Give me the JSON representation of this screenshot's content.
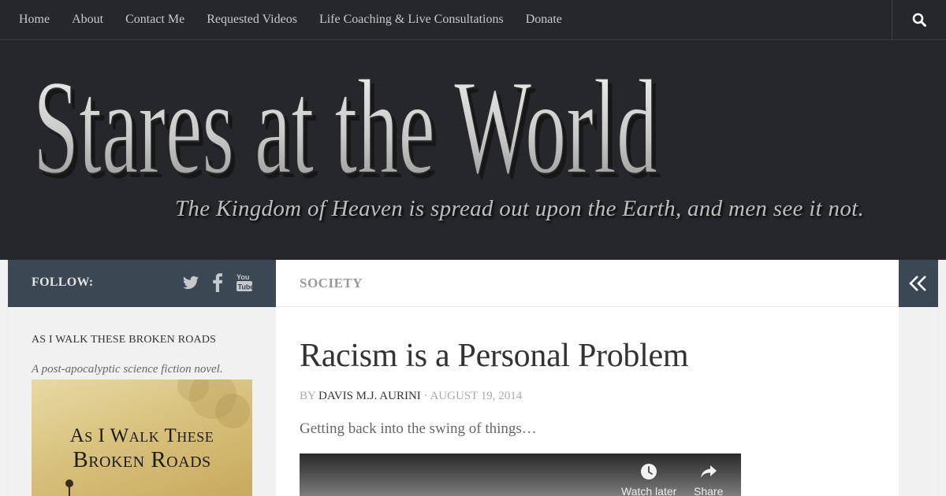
{
  "nav": {
    "items": [
      {
        "label": "Home"
      },
      {
        "label": "About"
      },
      {
        "label": "Contact Me"
      },
      {
        "label": "Requested Videos"
      },
      {
        "label": "Life Coaching & Live Consultations"
      },
      {
        "label": "Donate"
      }
    ],
    "search_icon": "search-icon"
  },
  "header": {
    "site_title": "Stares at the World",
    "tagline": "The Kingdom of Heaven is spread out upon the Earth, and men see it not."
  },
  "sidebar": {
    "follow_label": "FOLLOW:",
    "social_icons": [
      "twitter-icon",
      "facebook-icon",
      "youtube-icon"
    ],
    "widget_title": "AS I WALK THESE BROKEN ROADS",
    "widget_caption": "A post-apocalyptic science fiction novel.",
    "book_line1": "As I Walk These",
    "book_line2": "Broken Roads"
  },
  "post": {
    "category": "SOCIETY",
    "title": "Racism is a Personal Problem",
    "by": "BY",
    "author": "DAVIS M.J. AURINI",
    "separator": "·",
    "date": "AUGUST 19, 2014",
    "excerpt": "Getting back into the swing of things…",
    "video": {
      "watch_later": "Watch later",
      "share": "Share"
    }
  },
  "colors": {
    "nav_bg": "#26272b",
    "bar_bg": "#3b4752",
    "content_bg": "#ffffff"
  }
}
